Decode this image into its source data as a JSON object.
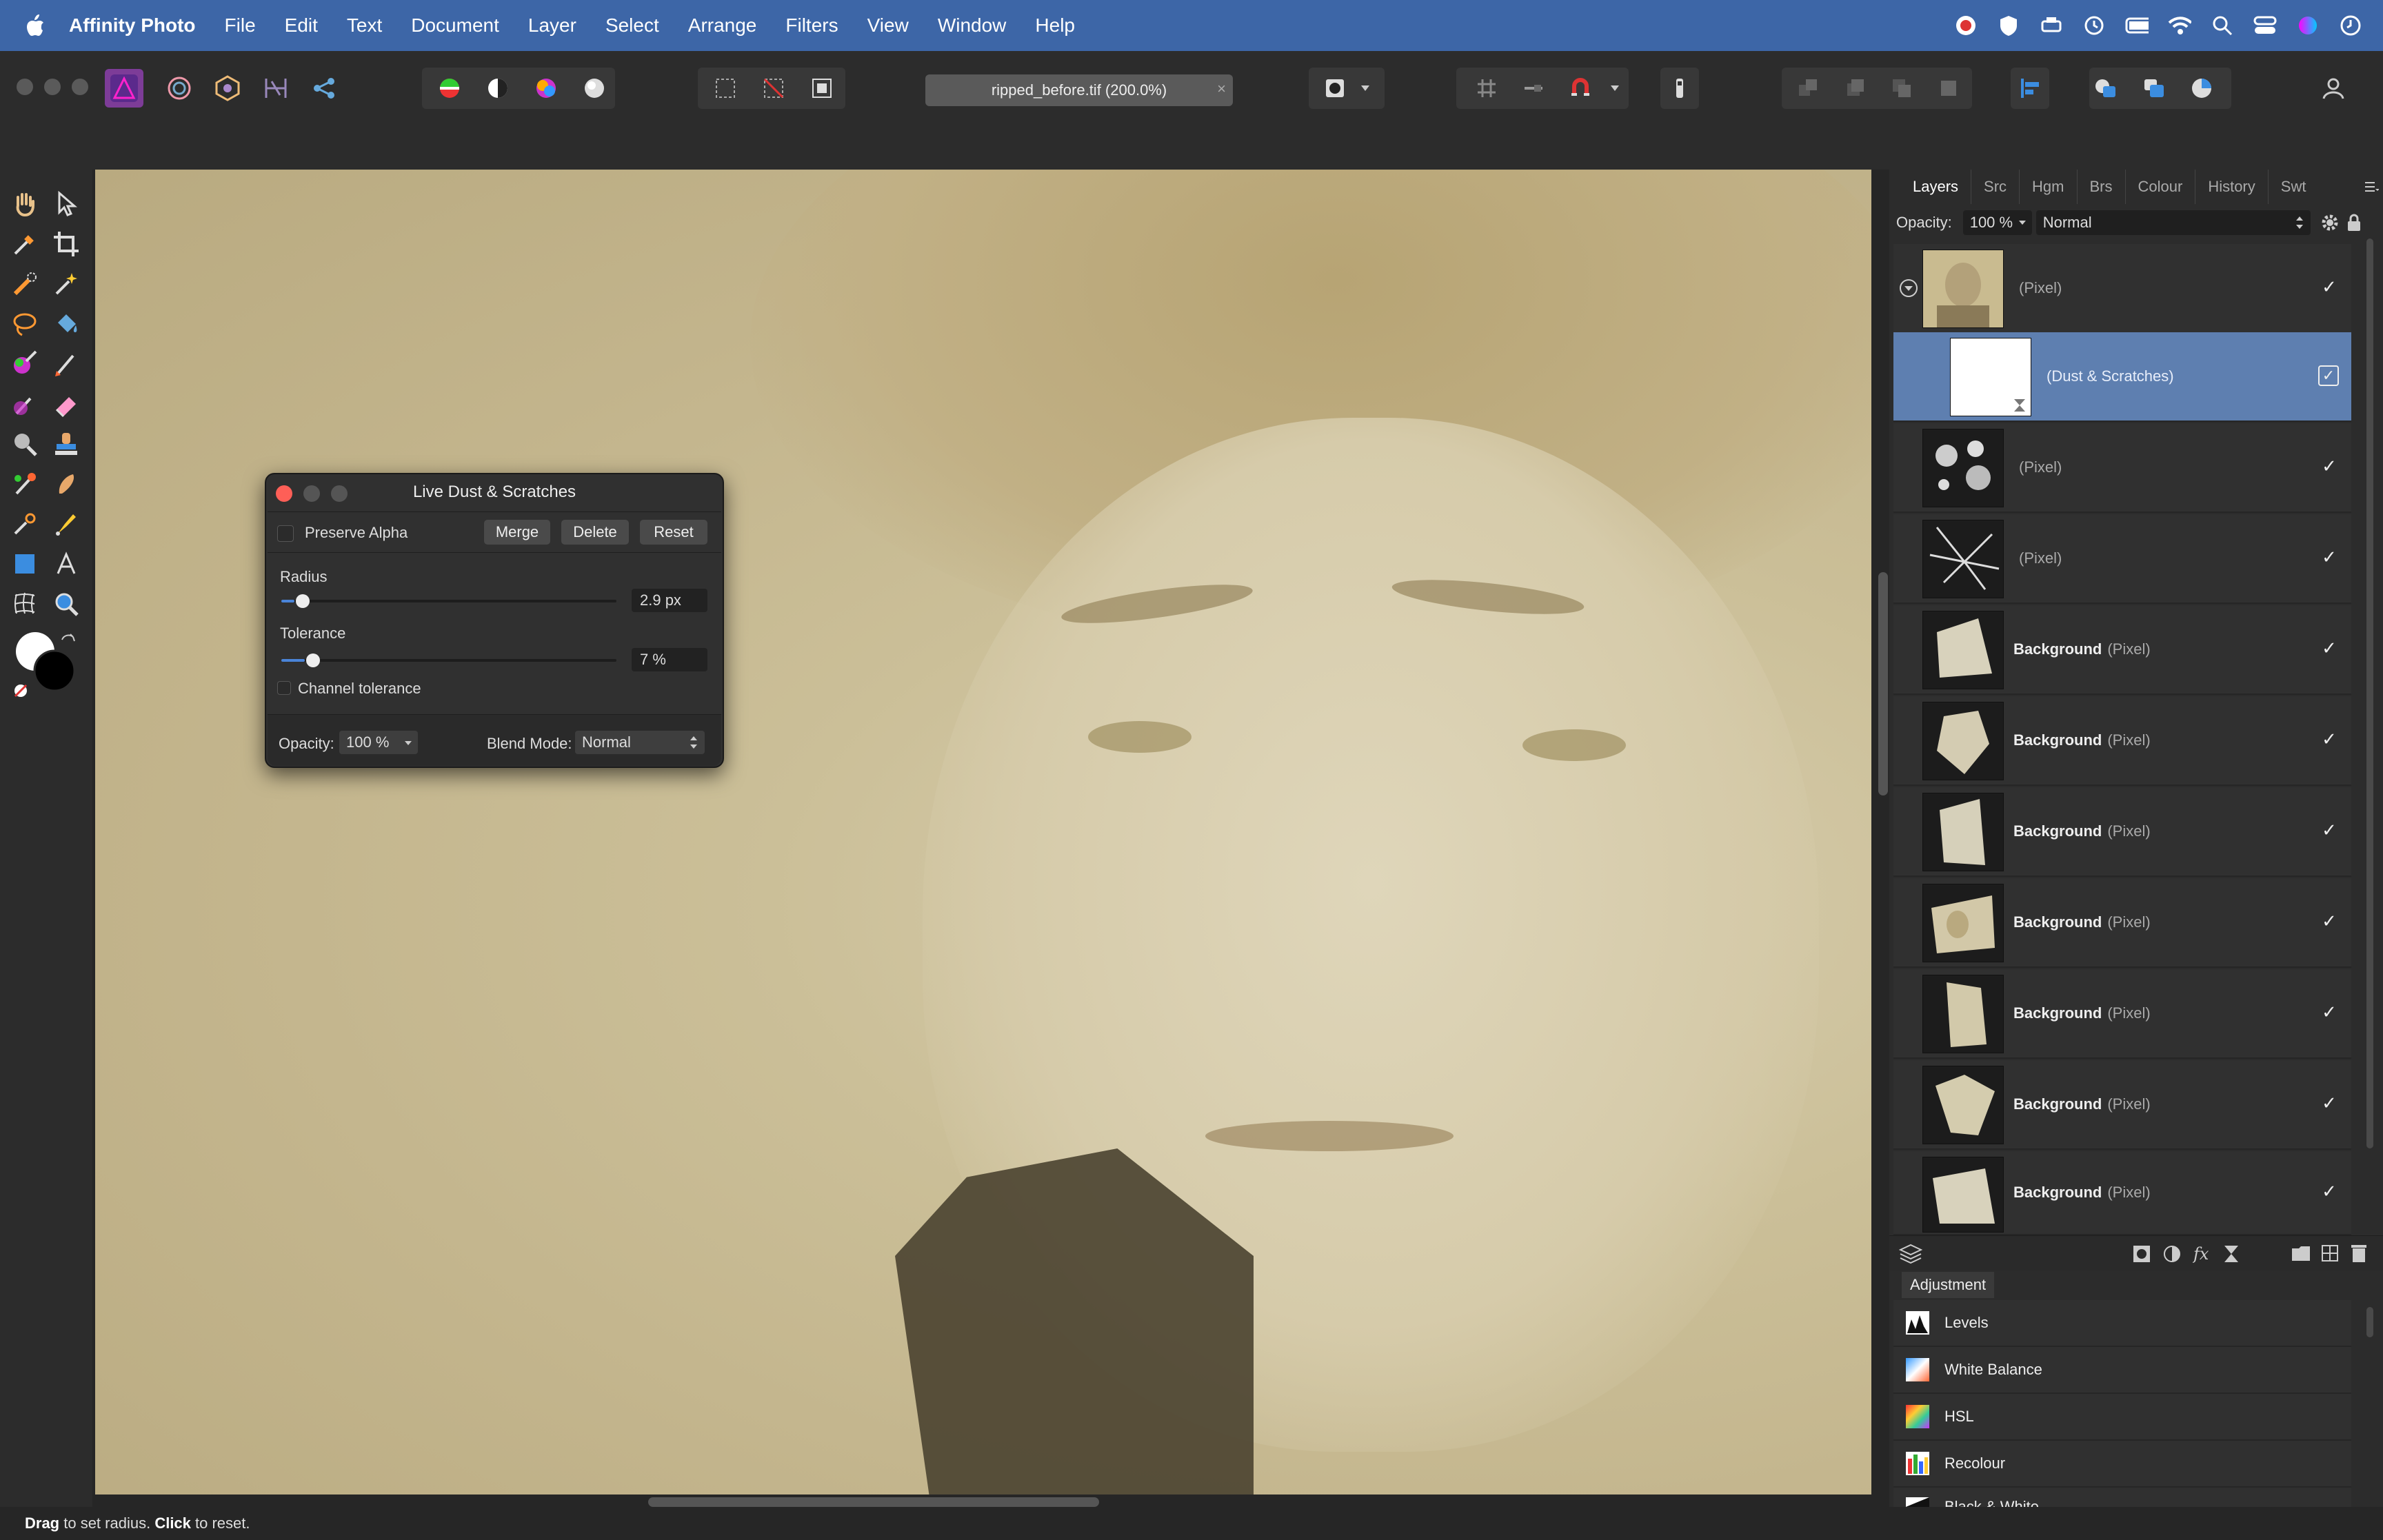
{
  "menubar": {
    "app_name": "Affinity Photo",
    "items": [
      "File",
      "Edit",
      "Text",
      "Document",
      "Layer",
      "Select",
      "Arrange",
      "Filters",
      "View",
      "Window",
      "Help"
    ]
  },
  "toolbar": {
    "document_title": "ripped_before.tif (200.0%)",
    "close_glyph": "×"
  },
  "dialog": {
    "title": "Live Dust & Scratches",
    "preserve_alpha": "Preserve Alpha",
    "merge": "Merge",
    "delete": "Delete",
    "reset": "Reset",
    "radius_label": "Radius",
    "radius_value": "2.9 px",
    "radius_level": 0.04,
    "tolerance_label": "Tolerance",
    "tolerance_value": "7 %",
    "tolerance_level": 0.07,
    "channel_tolerance": "Channel tolerance",
    "opacity_label": "Opacity:",
    "opacity_value": "100 %",
    "blend_label": "Blend Mode:",
    "blend_value": "Normal"
  },
  "panel": {
    "tabs": [
      "Layers",
      "Src",
      "Hgm",
      "Brs",
      "Colour",
      "History",
      "Swt"
    ],
    "opacity_label": "Opacity:",
    "opacity_value": "100 %",
    "blend_value": "Normal",
    "layers": [
      {
        "name": "",
        "type": "(Pixel)"
      },
      {
        "name": "",
        "type": "(Dust & Scratches)"
      },
      {
        "name": "",
        "type": "(Pixel)"
      },
      {
        "name": "",
        "type": "(Pixel)"
      },
      {
        "name": "Background",
        "type": "(Pixel)"
      },
      {
        "name": "Background",
        "type": "(Pixel)"
      },
      {
        "name": "Background",
        "type": "(Pixel)"
      },
      {
        "name": "Background",
        "type": "(Pixel)"
      },
      {
        "name": "Background",
        "type": "(Pixel)"
      },
      {
        "name": "Background",
        "type": "(Pixel)"
      },
      {
        "name": "Background",
        "type": "(Pixel)"
      }
    ],
    "check_glyph": "✓",
    "adjustment_title": "Adjustment",
    "adjustments": [
      "Levels",
      "White Balance",
      "HSL",
      "Recolour",
      "Black & White"
    ]
  },
  "status": {
    "drag": "Drag",
    "drag_text": " to set radius. ",
    "click": "Click",
    "click_text": " to reset."
  },
  "colors": {
    "menubar": "#3d66a7",
    "selection": "#5e7fb0",
    "accent": "#4a84d8",
    "close_light": "#fe5f57"
  }
}
